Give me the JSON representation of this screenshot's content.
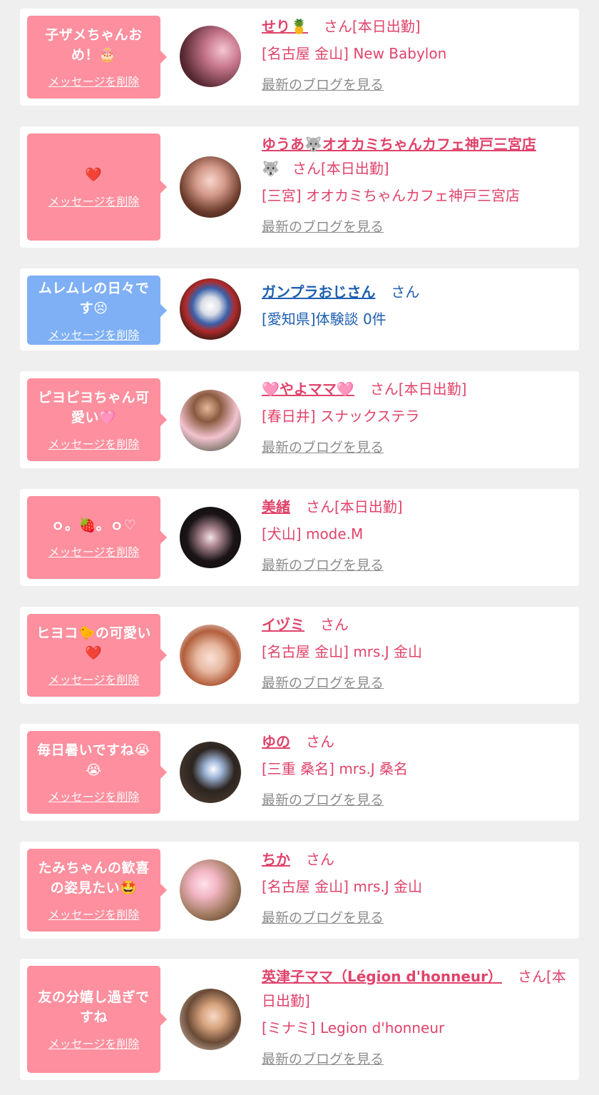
{
  "delete_label": "メッセージを削除",
  "blog_label": "最新のブログを見る",
  "cards": [
    {
      "message": "子ザメちゃんお\nめ！🎂",
      "name": "せり🍍",
      "suffix": "さん[本日出勤]",
      "shop": "[名古屋 金山] New Babylon",
      "blog": true
    },
    {
      "message": "❤️",
      "name": "ゆうあ🐺オオカミちゃんカフェ神戸三宮店",
      "name2": "🐺",
      "suffix": "さん[本日出勤]",
      "shop": "[三宮] オオカミちゃんカフェ神戸三宮店",
      "blog": true
    },
    {
      "message": "ムレムレの日々で\nす😣",
      "name": "ガンプラおじさん",
      "suffix": "さん",
      "shop": "[愛知県]体験談 0件",
      "blog": false
    },
    {
      "message": "ピヨピヨちゃん可\n愛い🩷",
      "name": "🩷やよママ🩷",
      "suffix": "さん[本日出勤]",
      "shop": "[春日井] スナックステラ",
      "blog": true
    },
    {
      "message": "ｏ。🍓。ｏ♡",
      "name": "美緒",
      "suffix": "さん[本日出勤]",
      "shop": "[犬山] mode.M",
      "blog": true
    },
    {
      "message": "ヒヨコ🐤の可愛い\n❤️",
      "name": "イヅミ",
      "suffix": "さん",
      "shop": "[名古屋 金山] mrs.J 金山",
      "blog": true
    },
    {
      "message": "毎日暑いですね😭\n😭",
      "name": "ゆの",
      "suffix": "さん",
      "shop": "[三重 桑名] mrs.J 桑名",
      "blog": true
    },
    {
      "message": "たみちゃんの歓喜\nの姿見たい🤩",
      "name": "ちか",
      "suffix": "さん",
      "shop": "[名古屋 金山] mrs.J 金山",
      "blog": true
    },
    {
      "message": "友の分嬉し過ぎで\nすね",
      "name": "英津子ママ（Légion d'honneur）",
      "suffix": "さん[本",
      "suffix2": "日出勤]",
      "shop": "[ミナミ] Legion d'honneur",
      "blog": true
    }
  ]
}
